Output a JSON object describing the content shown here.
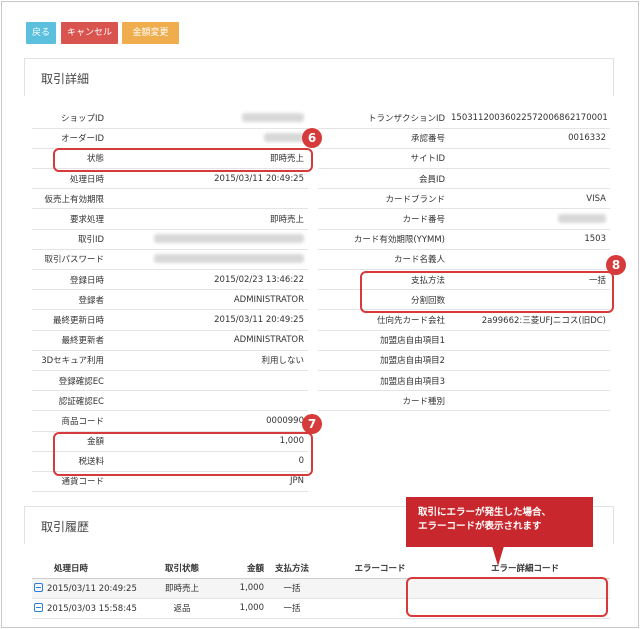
{
  "toolbar": {
    "back_label": "戻る",
    "cancel_label": "キャンセル",
    "amount_change_label": "金額変更",
    "back_color": "#5bc0de",
    "cancel_color": "#d9534f",
    "amount_change_color": "#f0ad4e"
  },
  "details": {
    "title": "取引詳細",
    "left": [
      {
        "label": "ショップID",
        "value": "",
        "masked": true
      },
      {
        "label": "オーダーID",
        "value": "",
        "masked": true
      },
      {
        "label": "状態",
        "value": "即時売上"
      },
      {
        "label": "処理日時",
        "value": "2015/03/11 20:49:25"
      },
      {
        "label": "仮売上有効期限",
        "value": ""
      },
      {
        "label": "要求処理",
        "value": "即時売上"
      },
      {
        "label": "取引ID",
        "value": "",
        "masked": true
      },
      {
        "label": "取引パスワード",
        "value": "",
        "masked": true
      },
      {
        "label": "登録日時",
        "value": "2015/02/23 13:46:22"
      },
      {
        "label": "登録者",
        "value": "ADMINISTRATOR"
      },
      {
        "label": "最終更新日時",
        "value": "2015/03/11 20:49:25"
      },
      {
        "label": "最終更新者",
        "value": "ADMINISTRATOR"
      },
      {
        "label": "3Dセキュア利用",
        "value": "利用しない"
      },
      {
        "label": "登録確認EC",
        "value": ""
      },
      {
        "label": "認証確認EC",
        "value": ""
      },
      {
        "label": "商品コード",
        "value": "0000990"
      },
      {
        "label": "金額",
        "value": "1,000"
      },
      {
        "label": "税送料",
        "value": "0"
      },
      {
        "label": "通貨コード",
        "value": "JPN"
      }
    ],
    "right": [
      {
        "label": "トランザクションID",
        "value": "15031120036022572006862170001"
      },
      {
        "label": "承認番号",
        "value": "0016332"
      },
      {
        "label": "サイトID",
        "value": ""
      },
      {
        "label": "会員ID",
        "value": ""
      },
      {
        "label": "カードブランド",
        "value": "VISA"
      },
      {
        "label": "カード番号",
        "value": "",
        "masked": true
      },
      {
        "label": "カード有効期限(YYMM)",
        "value": "1503"
      },
      {
        "label": "カード名義人",
        "value": ""
      },
      {
        "label": "支払方法",
        "value": "一括"
      },
      {
        "label": "分割回数",
        "value": ""
      },
      {
        "label": "仕向先カード会社",
        "value": "2a99662:三菱UFJニコス(旧DC)"
      },
      {
        "label": "加盟店自由項目1",
        "value": ""
      },
      {
        "label": "加盟店自由項目2",
        "value": ""
      },
      {
        "label": "加盟店自由項目3",
        "value": ""
      },
      {
        "label": "カード種別",
        "value": ""
      }
    ]
  },
  "history": {
    "title": "取引履歴",
    "columns": [
      "処理日時",
      "取引状態",
      "金額",
      "支払方法",
      "エラーコード",
      "エラー詳細コード"
    ],
    "rows": [
      {
        "date": "2015/03/11 20:49:25",
        "status": "即時売上",
        "amount": "1,000",
        "method": "一括",
        "error_code": "",
        "error_detail": ""
      },
      {
        "date": "2015/03/03 15:58:45",
        "status": "返品",
        "amount": "1,000",
        "method": "一括",
        "error_code": "",
        "error_detail": ""
      }
    ]
  },
  "annotations": {
    "badge6": "6",
    "badge7": "7",
    "badge8": "8",
    "callout_line1": "取引にエラーが発生した場合、",
    "callout_line2": "エラーコードが表示されます",
    "highlight_color": "#d63a3a",
    "callout_color": "#c8272d"
  }
}
